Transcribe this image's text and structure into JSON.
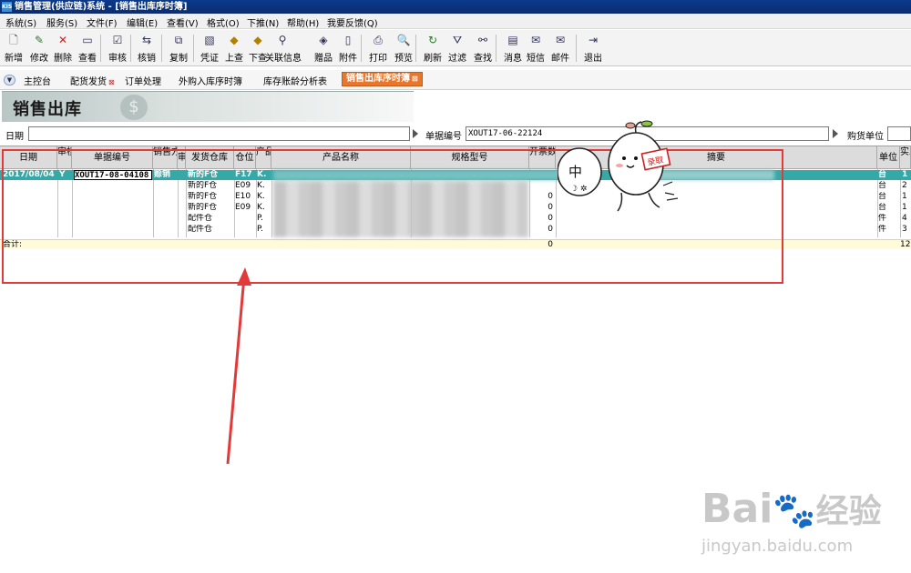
{
  "window": {
    "icon_text": "KIS",
    "title": "销售管理(供应链)系统 - [销售出库序时簿]"
  },
  "menu": [
    "系统(S)",
    "服务(S)",
    "文件(F)",
    "编辑(E)",
    "查看(V)",
    "格式(O)",
    "下推(N)",
    "帮助(H)",
    "我要反馈(Q)"
  ],
  "toolbar": [
    {
      "label": "新增",
      "icon": "new-icon",
      "glyph": "🗋"
    },
    {
      "label": "修改",
      "icon": "edit-icon",
      "glyph": "✎"
    },
    {
      "label": "删除",
      "icon": "delete-icon",
      "glyph": "✕"
    },
    {
      "label": "查看",
      "icon": "view-icon",
      "glyph": "▭"
    },
    {
      "label": "审核",
      "icon": "audit-icon",
      "glyph": "☑"
    },
    {
      "label": "核销",
      "icon": "writeoff-icon",
      "glyph": "⇆"
    },
    {
      "label": "复制",
      "icon": "copy-icon",
      "glyph": "⧉"
    },
    {
      "label": "凭证",
      "icon": "voucher-icon",
      "glyph": "▧"
    },
    {
      "label": "上查",
      "icon": "up-query-icon",
      "glyph": "◆"
    },
    {
      "label": "下查",
      "icon": "down-query-icon",
      "glyph": "◆"
    },
    {
      "label": "关联信息",
      "icon": "related-info-icon",
      "glyph": "⚲"
    },
    {
      "label": "赠品",
      "icon": "gift-icon",
      "glyph": "◈"
    },
    {
      "label": "附件",
      "icon": "attachment-icon",
      "glyph": "▯"
    },
    {
      "label": "打印",
      "icon": "print-icon",
      "glyph": "⎙"
    },
    {
      "label": "预览",
      "icon": "preview-icon",
      "glyph": "🔍"
    },
    {
      "label": "刷新",
      "icon": "refresh-icon",
      "glyph": "↻"
    },
    {
      "label": "过滤",
      "icon": "filter-icon",
      "glyph": "⛛"
    },
    {
      "label": "查找",
      "icon": "find-icon",
      "glyph": "⚯"
    },
    {
      "label": "消息",
      "icon": "message-icon",
      "glyph": "▤"
    },
    {
      "label": "短信",
      "icon": "sms-icon",
      "glyph": "✉"
    },
    {
      "label": "邮件",
      "icon": "mail-icon",
      "glyph": "✉"
    },
    {
      "label": "退出",
      "icon": "exit-icon",
      "glyph": "⇥"
    }
  ],
  "tabs": [
    {
      "label": "主控台",
      "closable": false,
      "active": false
    },
    {
      "label": "配货发货",
      "closable": true,
      "active": false
    },
    {
      "label": "订单处理",
      "closable": false,
      "active": false
    },
    {
      "label": "外购入库序时簿",
      "closable": false,
      "active": false
    },
    {
      "label": "库存账龄分析表",
      "closable": false,
      "active": false
    },
    {
      "label": "销售出库序时簿",
      "closable": true,
      "active": true
    }
  ],
  "banner": {
    "title": "销售出库",
    "decor": "$"
  },
  "filters": {
    "date_label": "日期",
    "bill_no_label": "单据编号",
    "bill_no_value": "XOUT17-06-22124",
    "buyer_label": "购货单位"
  },
  "columns": [
    "日期",
    "审核标志",
    "单据编号",
    "销售方式",
    "审",
    "发货仓库",
    "仓位",
    "产品长代",
    "产品名称",
    "规格型号",
    "开票数量",
    "摘要",
    "单位",
    "实发数量"
  ],
  "rows": [
    {
      "date": "2017/08/04",
      "flag": "Y",
      "bill": "XOUT17-08-04108",
      "method": "赊销",
      "warehouse": "新的F仓",
      "pos": "F17",
      "code": "K.",
      "qty_inv": "",
      "unit": "台",
      "qty": "1",
      "selected": true
    },
    {
      "date": "",
      "flag": "",
      "bill": "",
      "method": "",
      "warehouse": "新的F仓",
      "pos": "E09",
      "code": "K.",
      "qty_inv": "",
      "unit": "台",
      "qty": "2",
      "selected": false
    },
    {
      "date": "",
      "flag": "",
      "bill": "",
      "method": "",
      "warehouse": "新的F仓",
      "pos": "E10",
      "code": "K.",
      "qty_inv": "0",
      "unit": "台",
      "qty": "1",
      "selected": false
    },
    {
      "date": "",
      "flag": "",
      "bill": "",
      "method": "",
      "warehouse": "新的F仓",
      "pos": "E09",
      "code": "K.",
      "qty_inv": "0",
      "unit": "台",
      "qty": "1",
      "selected": false
    },
    {
      "date": "",
      "flag": "",
      "bill": "",
      "method": "",
      "warehouse": "配件仓",
      "pos": "",
      "code": "P.",
      "qty_inv": "0",
      "unit": "件",
      "qty": "4",
      "selected": false
    },
    {
      "date": "",
      "flag": "",
      "bill": "",
      "method": "",
      "warehouse": "配件仓",
      "pos": "",
      "code": "P.",
      "qty_inv": "0",
      "unit": "件",
      "qty": "3",
      "selected": false
    }
  ],
  "total": {
    "label": "合计:",
    "qty_inv": "0",
    "qty": "12"
  },
  "sticker": {
    "speech": "中",
    "sign": "录取"
  },
  "watermark": {
    "brand": "Bai",
    "brand2": "经验",
    "url": "jingyan.baidu.com"
  }
}
